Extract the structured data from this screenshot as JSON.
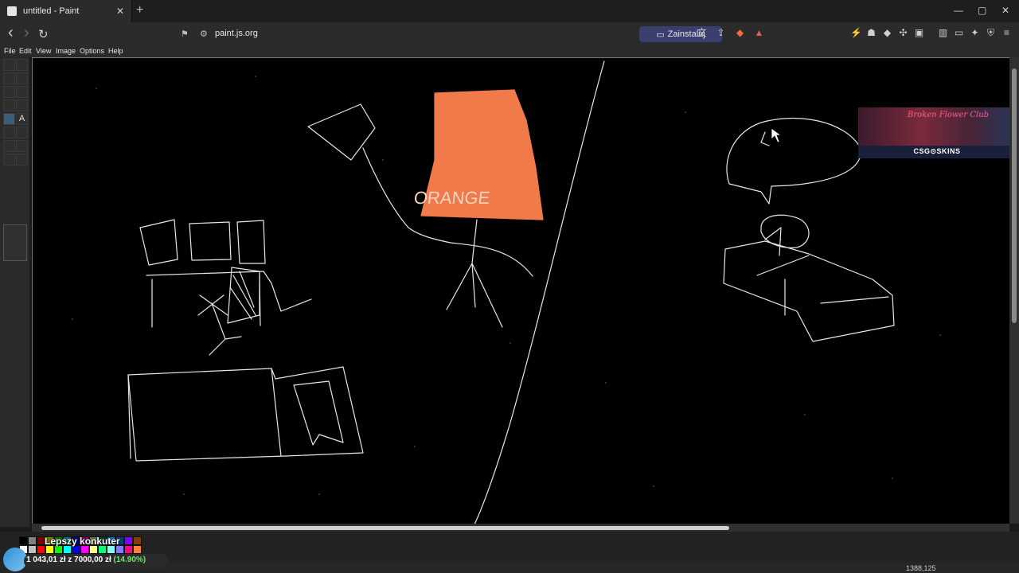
{
  "browser": {
    "tab_title": "untitled - Paint",
    "tab_close": "✕",
    "new_tab": "+",
    "url": "paint.js.org",
    "install_label": "Zainstaluj",
    "window_controls": {
      "minimize": "—",
      "maximize": "▢",
      "close": "✕"
    },
    "nav": {
      "back": "‹",
      "forward": "›",
      "reload": "↻"
    }
  },
  "paint": {
    "menus": [
      "File",
      "Edit",
      "View",
      "Image",
      "Options",
      "Help"
    ],
    "canvas_text": "ORANGE",
    "status_coords": "1388,125",
    "accent_color": "#f07a4a",
    "palette": [
      "#000000",
      "#808080",
      "#800000",
      "#808000",
      "#008000",
      "#008080",
      "#000080",
      "#800080",
      "#808040",
      "#004040",
      "#0080ff",
      "#004080",
      "#8000ff",
      "#804000",
      "#ffffff",
      "#c0c0c0",
      "#ff0000",
      "#ffff00",
      "#00ff00",
      "#00ffff",
      "#0000ff",
      "#ff00ff",
      "#ffff80",
      "#00ff80",
      "#80ffff",
      "#8080ff",
      "#ff0080",
      "#ff8040"
    ]
  },
  "overlay": {
    "title": "Lepszy konkuter",
    "amount": "1 043,01 zł z 7000,00 zł",
    "percent": "(14.90%)"
  },
  "ad": {
    "label": "CSG⊙SKINS",
    "sign": "Broken Flower Club"
  }
}
